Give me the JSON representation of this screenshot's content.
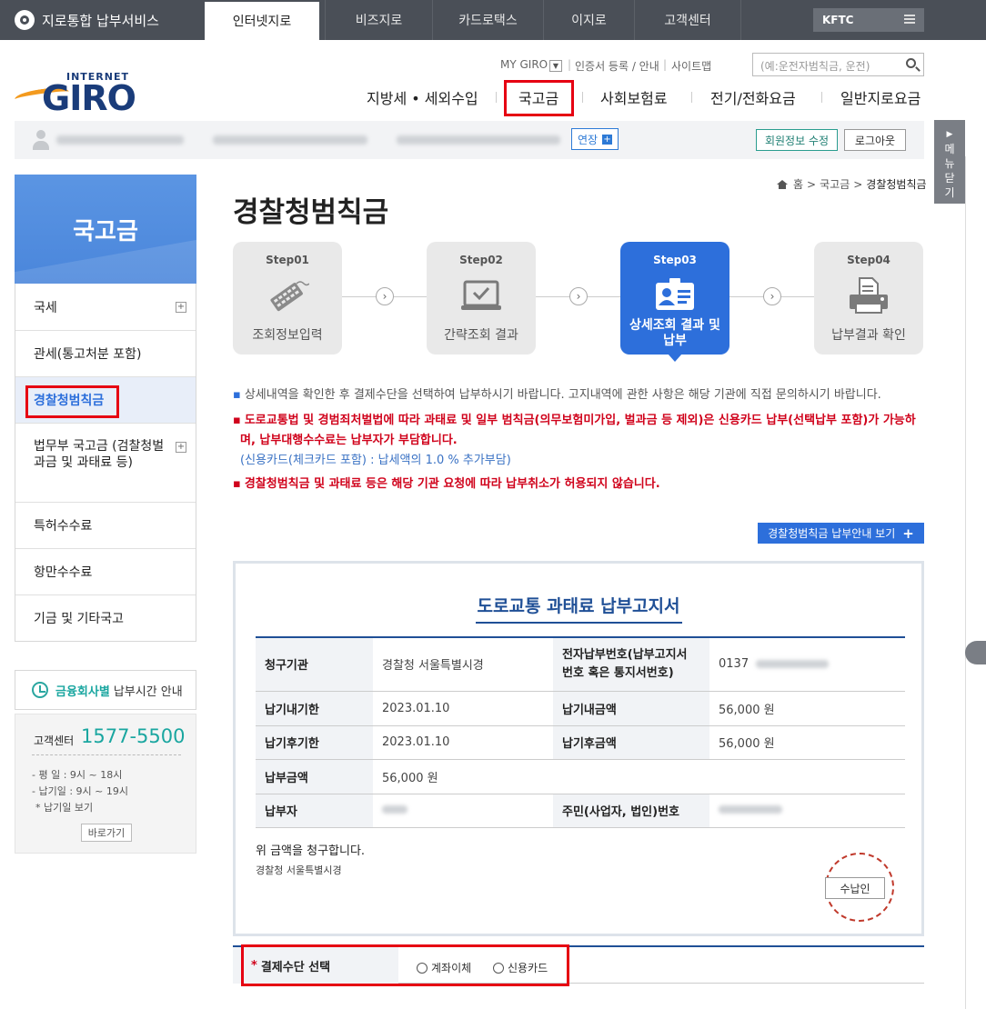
{
  "topbar": {
    "brand": "지로통합 납부서비스",
    "tabs": [
      {
        "label": "인터넷지로",
        "active": true
      },
      {
        "label": "비즈지로",
        "active": false
      },
      {
        "label": "카드로택스",
        "active": false
      },
      {
        "label": "이지로",
        "active": false
      },
      {
        "label": "고객센터",
        "active": false
      }
    ],
    "kftc": "KFTC"
  },
  "header": {
    "logo_small": "INTERNET",
    "logo_main": "GIRO",
    "util": {
      "my_giro": "MY GIRO",
      "cert": "인증서 등록 / 안내",
      "sitemap": "사이트맵"
    },
    "search_placeholder": "(예:운전자범칙금, 운전)",
    "gnb": [
      {
        "label": "지방세 • 세외수입"
      },
      {
        "label": "국고금"
      },
      {
        "label": "사회보험료"
      },
      {
        "label": "전기/전화요금"
      },
      {
        "label": "일반지로요금"
      }
    ]
  },
  "userbar": {
    "extend_label": "연장",
    "edit_label": "회원정보 수정",
    "logout_label": "로그아웃"
  },
  "menu_close": [
    "메",
    "뉴",
    "닫",
    "기"
  ],
  "sidebar": {
    "title": "국고금",
    "items": [
      {
        "label": "국세",
        "has_plus": true
      },
      {
        "label": "관세(통고처분 포함)",
        "has_plus": false
      },
      {
        "label": "경찰청범칙금",
        "has_plus": false,
        "selected": true
      },
      {
        "label": "법무부 국고금 (검찰청벌과금 및 과태료 등)",
        "has_plus": true
      },
      {
        "label": "특허수수료",
        "has_plus": false
      },
      {
        "label": "항만수수료",
        "has_plus": false
      },
      {
        "label": "기금 및 기타국고",
        "has_plus": false
      }
    ],
    "bank_time": {
      "highlight": "금융회사별",
      "rest": "납부시간 안내"
    },
    "cs": {
      "label": "고객센터",
      "phone": "1577-5500",
      "weekday": "- 평   일 : 9시 ~ 18시",
      "dueday": "- 납기일 : 9시 ~ 19시",
      "due_link": "* 납기일 보기",
      "go": "바로가기"
    }
  },
  "breadcrumb": {
    "home": "홈",
    "sep": ">",
    "level1": "국고금",
    "level2": "경찰청범칙금"
  },
  "page_title": "경찰청범칙금",
  "steps": [
    {
      "num": "Step01",
      "label": "조회정보입력",
      "icon": "keyboard-icon"
    },
    {
      "num": "Step02",
      "label": "간략조회 결과",
      "icon": "monitor-check-icon"
    },
    {
      "num": "Step03",
      "label1": "상세조회 결과 및",
      "label2": "납부",
      "icon": "id-card-icon",
      "active": true
    },
    {
      "num": "Step04",
      "label": "납부결과 확인",
      "icon": "printer-icon"
    }
  ],
  "notices": {
    "n1": "상세내역을 확인한 후 결제수단을 선택하여 납부하시기 바랍니다. 고지내역에 관한 사항은 해당 기관에 직접 문의하시기 바랍니다.",
    "n2a": "도로교통법 및 경범죄처벌법에 따라 과태료 및 일부 범칙금(의무보험미가입, 벌과금 등 제외)은 신용카드 납부(선택납부 포함)가 가능하",
    "n2b": "며, 납부대행수수료는 납부자가 부담합니다.",
    "n2c": "(신용카드(체크카드 포함) : 납세액의 1.0 % 추가부담)",
    "n3": "경찰청범칙금 및 과태료 등은 해당 기관 요청에 따라 납부취소가 허용되지 않습니다."
  },
  "guide_button": "경찰청범칙금 납부안내 보기",
  "bill": {
    "title": "도로교통 과태료 납부고지서",
    "rows": {
      "agency_label": "청구기관",
      "agency": "경찰청 서울특별시경",
      "elec_label1": "전자납부번호(납부고지서",
      "elec_label2": "번호 혹은 통지서번호)",
      "elec_no": "0137",
      "due_label": "납기내기한",
      "due": "2023.01.10",
      "due_amt_label": "납기내금액",
      "due_amt": "56,000 원",
      "after_label": "납기후기한",
      "after": "2023.01.10",
      "after_amt_label": "납기후금액",
      "after_amt": "56,000 원",
      "pay_amt_label": "납부금액",
      "pay_amt": "56,000 원",
      "payer_label": "납부자",
      "reg_label": "주민(사업자, 법인)번호"
    },
    "claim": "위 금액을 청구합니다.",
    "org": "경찰청 서울특별시경",
    "stamp": "수납인"
  },
  "payment": {
    "label": "결제수단 선택",
    "options": [
      "계좌이체",
      "신용카드"
    ]
  },
  "colors": {
    "topbar": "#4a4f57",
    "accent_blue": "#2d6fdb",
    "teal": "#1aa6a0",
    "highlight_red": "#e60012",
    "notice_red": "#d0021b"
  }
}
